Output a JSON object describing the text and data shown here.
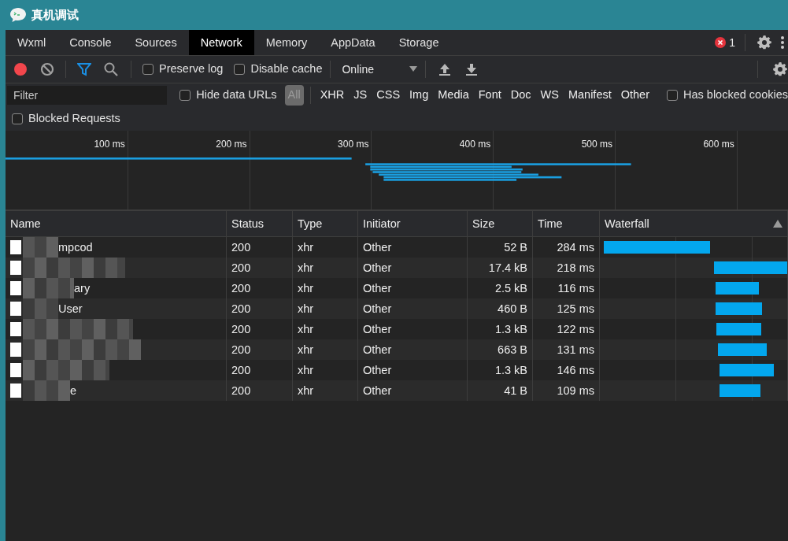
{
  "window": {
    "title": "真机调试"
  },
  "tabs": [
    {
      "label": "Wxml",
      "selected": false
    },
    {
      "label": "Console",
      "selected": false
    },
    {
      "label": "Sources",
      "selected": false
    },
    {
      "label": "Network",
      "selected": true
    },
    {
      "label": "Memory",
      "selected": false
    },
    {
      "label": "AppData",
      "selected": false
    },
    {
      "label": "Storage",
      "selected": false
    }
  ],
  "error_count": "1",
  "toolbar": {
    "recording": true,
    "filter_active": true,
    "preserve_log": {
      "label": "Preserve log",
      "checked": false
    },
    "disable_cache": {
      "label": "Disable cache",
      "checked": false
    },
    "throttling": "Online"
  },
  "filter_bar": {
    "placeholder": "Filter",
    "hide_data_urls": {
      "label": "Hide data URLs",
      "checked": false
    },
    "types": [
      {
        "label": "All",
        "selected": true
      },
      {
        "label": "XHR",
        "selected": false
      },
      {
        "label": "JS",
        "selected": false
      },
      {
        "label": "CSS",
        "selected": false
      },
      {
        "label": "Img",
        "selected": false
      },
      {
        "label": "Media",
        "selected": false
      },
      {
        "label": "Font",
        "selected": false
      },
      {
        "label": "Doc",
        "selected": false
      },
      {
        "label": "WS",
        "selected": false
      },
      {
        "label": "Manifest",
        "selected": false
      },
      {
        "label": "Other",
        "selected": false
      }
    ],
    "has_blocked_cookies": {
      "label": "Has blocked cookies",
      "checked": false
    },
    "blocked_requests": {
      "label": "Blocked Requests",
      "checked": false
    }
  },
  "overview": {
    "ticks": [
      "100 ms",
      "200 ms",
      "300 ms",
      "400 ms",
      "500 ms",
      "600 ms"
    ]
  },
  "table": {
    "columns": [
      "Name",
      "Status",
      "Type",
      "Initiator",
      "Size",
      "Time",
      "Waterfall"
    ],
    "rows": [
      {
        "name": "mpcod",
        "status": "200",
        "type": "xhr",
        "initiator": "Other",
        "size": "52 B",
        "time": "284 ms"
      },
      {
        "status": "200",
        "type": "xhr",
        "initiator": "Other",
        "size": "17.4 kB",
        "time": "218 ms"
      },
      {
        "name": "ary",
        "status": "200",
        "type": "xhr",
        "initiator": "Other",
        "size": "2.5 kB",
        "time": "116 ms"
      },
      {
        "name": "User",
        "status": "200",
        "type": "xhr",
        "initiator": "Other",
        "size": "460 B",
        "time": "125 ms"
      },
      {
        "status": "200",
        "type": "xhr",
        "initiator": "Other",
        "size": "1.3 kB",
        "time": "122 ms"
      },
      {
        "status": "200",
        "type": "xhr",
        "initiator": "Other",
        "size": "663 B",
        "time": "131 ms"
      },
      {
        "status": "200",
        "type": "xhr",
        "initiator": "Other",
        "size": "1.3 kB",
        "time": "146 ms"
      },
      {
        "name": "e",
        "status": "200",
        "type": "xhr",
        "initiator": "Other",
        "size": "41 B",
        "time": "109 ms"
      }
    ]
  }
}
